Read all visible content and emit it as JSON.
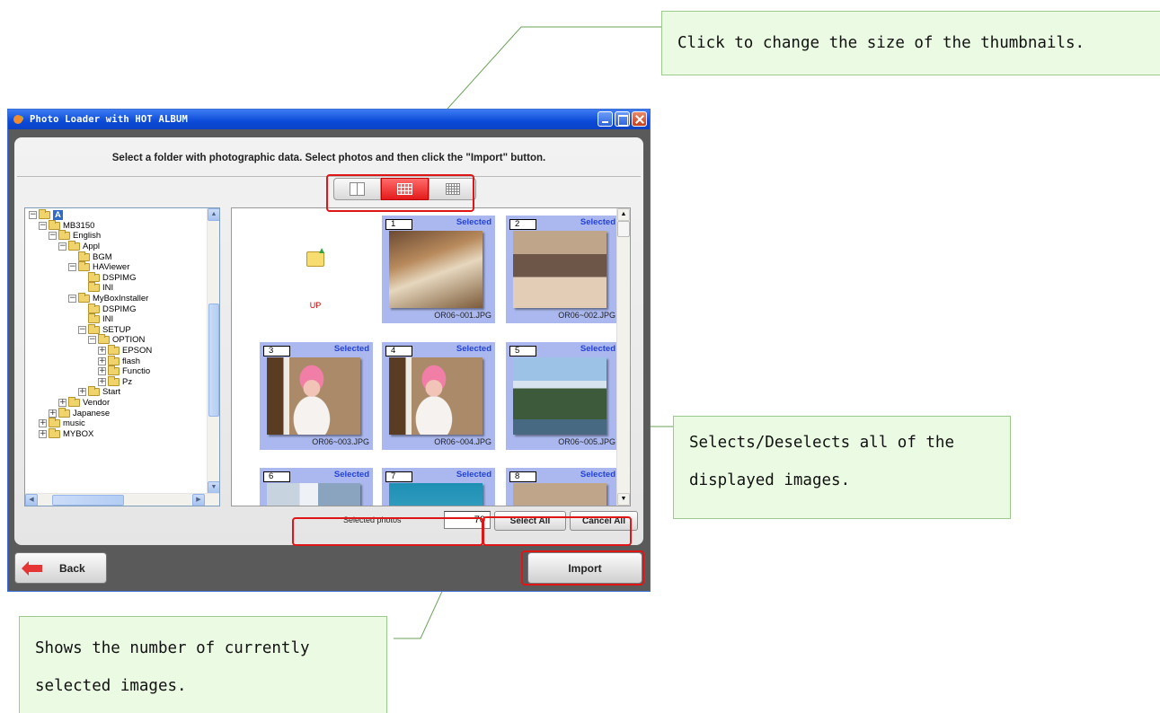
{
  "window": {
    "title": "Photo Loader with HOT ALBUM",
    "instruction": "Select a folder with photographic data. Select photos and then click the \"Import\" button."
  },
  "size_buttons": [
    {
      "name": "large-thumbnails",
      "icon": "grid-2x1-icon",
      "active": false
    },
    {
      "name": "medium-thumbnails",
      "icon": "grid-4x3-icon",
      "active": true
    },
    {
      "name": "small-thumbnails",
      "icon": "grid-5x4-icon",
      "active": false
    }
  ],
  "tree": {
    "items": [
      {
        "label": "A",
        "expander": "−",
        "depth": 0,
        "selected": true
      },
      {
        "label": "MB3150",
        "expander": "−",
        "depth": 1
      },
      {
        "label": "English",
        "expander": "−",
        "depth": 2
      },
      {
        "label": "Appl",
        "expander": "−",
        "depth": 3
      },
      {
        "label": "BGM",
        "expander": "",
        "depth": 4
      },
      {
        "label": "HAViewer",
        "expander": "−",
        "depth": 4
      },
      {
        "label": "DSPIMG",
        "expander": "",
        "depth": 5
      },
      {
        "label": "INI",
        "expander": "",
        "depth": 5
      },
      {
        "label": "MyBoxInstaller",
        "expander": "−",
        "depth": 4
      },
      {
        "label": "DSPIMG",
        "expander": "",
        "depth": 5
      },
      {
        "label": "INI",
        "expander": "",
        "depth": 5
      },
      {
        "label": "SETUP",
        "expander": "−",
        "depth": 5
      },
      {
        "label": "OPTION",
        "expander": "−",
        "depth": 6
      },
      {
        "label": "EPSON",
        "expander": "+",
        "depth": 7
      },
      {
        "label": "flash",
        "expander": "+",
        "depth": 7
      },
      {
        "label": "Functio",
        "expander": "+",
        "depth": 7
      },
      {
        "label": "Pz",
        "expander": "+",
        "depth": 7
      },
      {
        "label": "Start",
        "expander": "+",
        "depth": 5
      },
      {
        "label": "Vendor",
        "expander": "+",
        "depth": 3
      },
      {
        "label": "Japanese",
        "expander": "+",
        "depth": 2
      },
      {
        "label": "music",
        "expander": "+",
        "depth": 1
      },
      {
        "label": "MYBOX",
        "expander": "+",
        "depth": 1
      }
    ]
  },
  "up_label": "UP",
  "thumbnails": [
    {
      "number": "1",
      "status": "Selected",
      "filename": "OR06~001.JPG",
      "image": "family-dinner-photo"
    },
    {
      "number": "2",
      "status": "Selected",
      "filename": "OR06~002.JPG",
      "image": "family-group-photo"
    },
    {
      "number": "3",
      "status": "Selected",
      "filename": "OR06~003.JPG",
      "image": "girl-pink-hat-photo"
    },
    {
      "number": "4",
      "status": "Selected",
      "filename": "OR06~004.JPG",
      "image": "girl-pink-hat-photo"
    },
    {
      "number": "5",
      "status": "Selected",
      "filename": "OR06~005.JPG",
      "image": "palm-trees-photo"
    },
    {
      "number": "6",
      "status": "Selected",
      "filename": "",
      "image": "city-buildings-photo"
    },
    {
      "number": "7",
      "status": "Selected",
      "filename": "",
      "image": "swimming-pool-photo"
    },
    {
      "number": "8",
      "status": "Selected",
      "filename": "",
      "image": "people-photo"
    }
  ],
  "selection": {
    "label": "Selected photos",
    "count": "70",
    "select_all": "Select All",
    "cancel_all": "Cancel All"
  },
  "footer": {
    "back": "Back",
    "import": "Import"
  },
  "callouts": {
    "thumb_size": "Click to change the size of the thumbnails.",
    "select_all": "Selects/Deselects all of the displayed images.",
    "count": "Shows the number of currently selected images."
  },
  "colors": {
    "highlight": "#e01616",
    "callout_bg": "#ebfbe3",
    "titlebar": "#0b4ad8",
    "thumb_bg": "#aab8ef",
    "selected_text": "#2442d6"
  }
}
